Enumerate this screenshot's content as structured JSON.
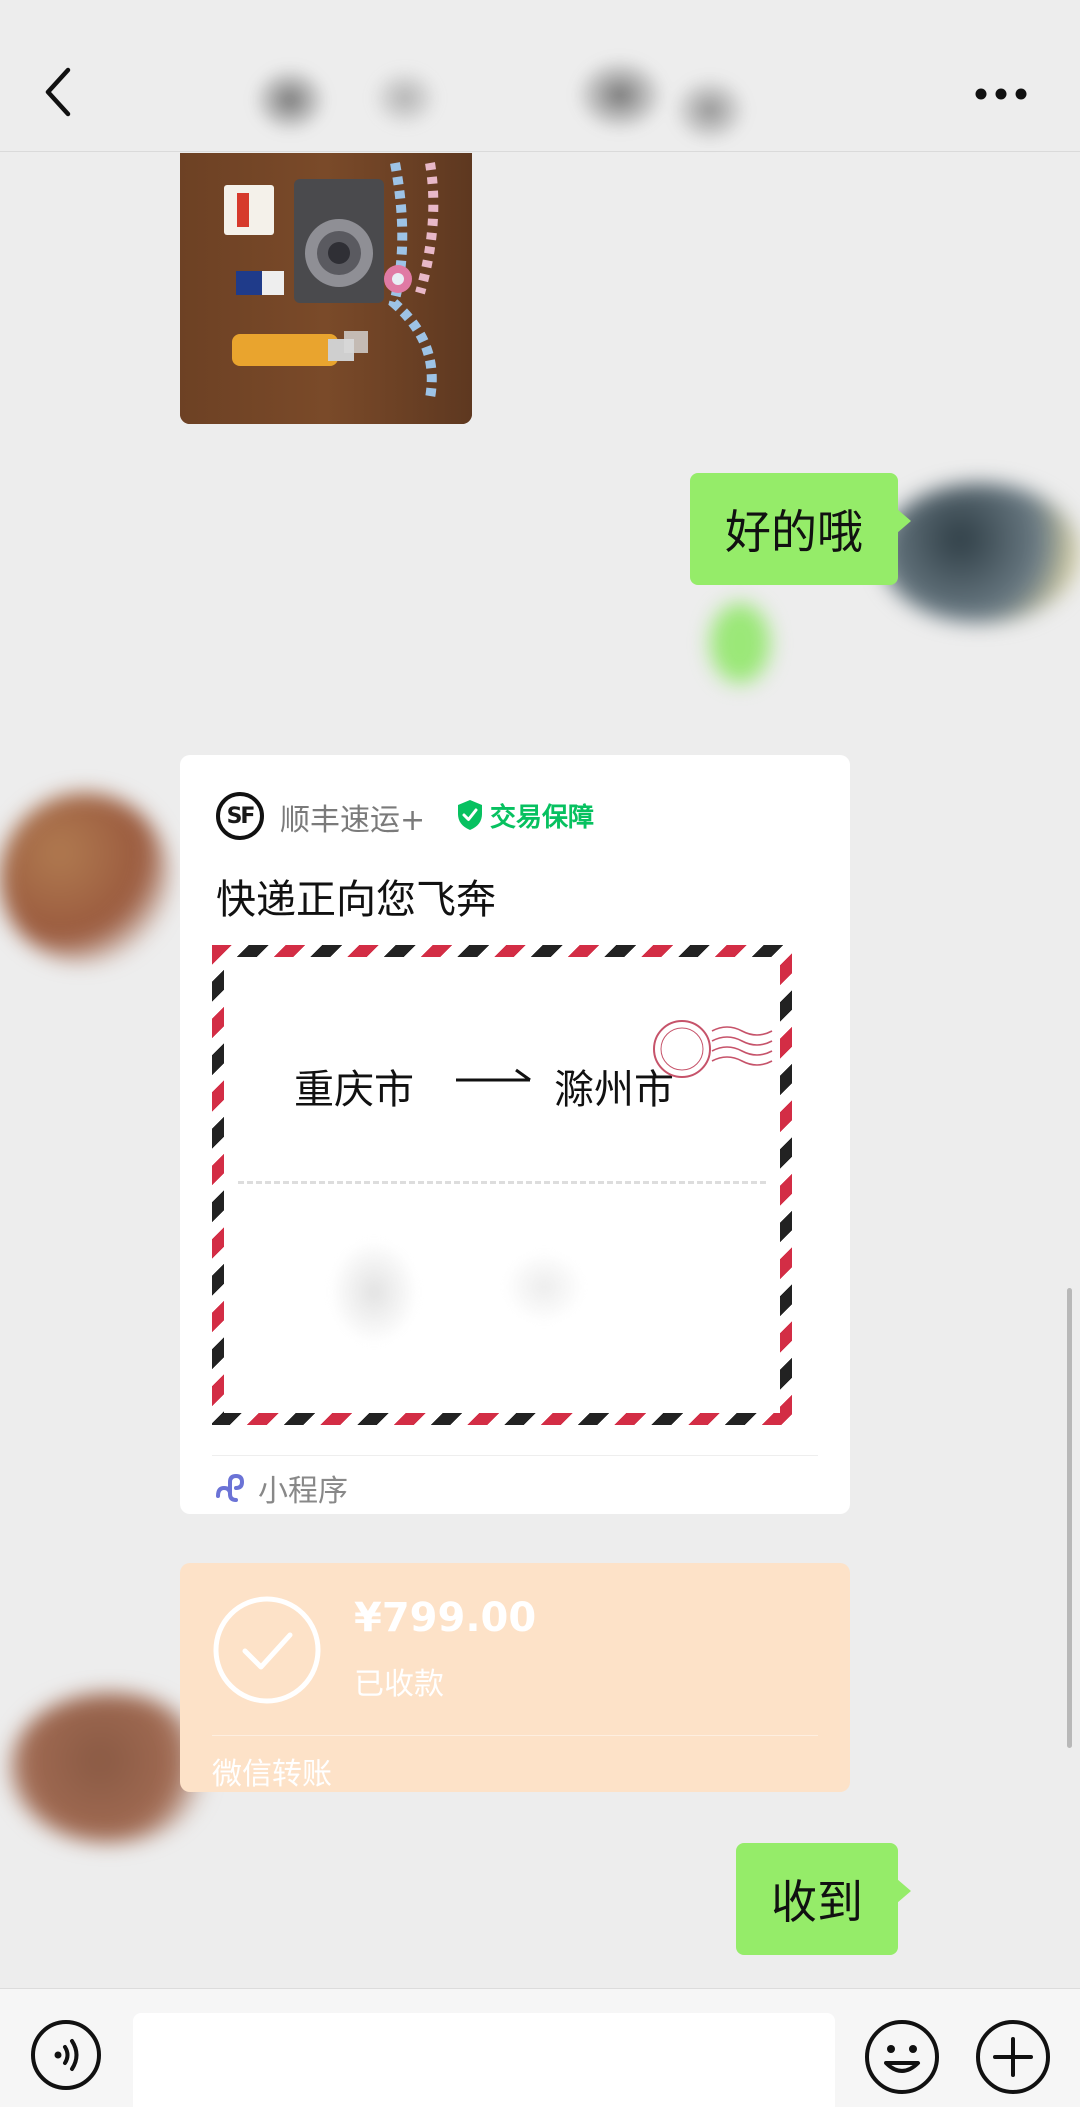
{
  "header": {
    "back_icon": "chevron-left-icon",
    "more_icon": "more-dots-icon"
  },
  "messages": [
    {
      "type": "image",
      "side": "left",
      "content": "photo of camera, SD cards, card reader and bead strap"
    },
    {
      "type": "text",
      "side": "right",
      "text": "好的哦"
    },
    {
      "type": "mini_program",
      "side": "left"
    },
    {
      "type": "transfer",
      "side": "left"
    },
    {
      "type": "text",
      "side": "right",
      "text": "收到"
    }
  ],
  "mini_program": {
    "logo_text": "SF",
    "brand": "顺丰速运+",
    "guarantee_label": "交易保障",
    "headline": "快递正向您飞奔",
    "from_city": "重庆市",
    "to_city": "滁州市",
    "footer_label": "小程序"
  },
  "transfer": {
    "amount": "¥799.00",
    "status": "已收款",
    "footer": "微信转账"
  },
  "input_bar": {
    "placeholder": "",
    "voice_icon": "voice-icon",
    "emoji_icon": "emoji-icon",
    "plus_icon": "plus-icon"
  },
  "colors": {
    "background": "#ededed",
    "bubble_green": "#95ec69",
    "transfer_received": "#fde2c8",
    "guarantee_green": "#07c160",
    "airmail_red": "#d32d45"
  }
}
